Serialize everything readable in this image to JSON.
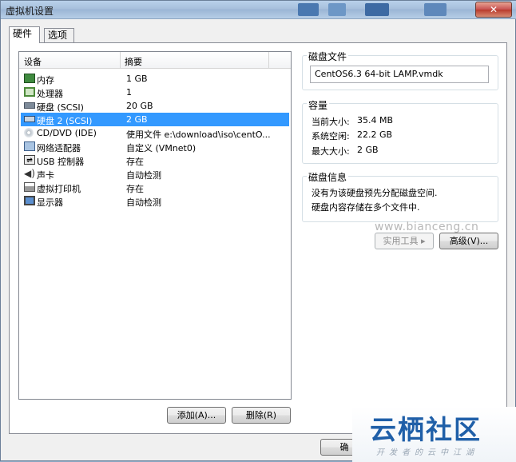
{
  "window": {
    "title": "虚拟机设置",
    "close_glyph": "✕"
  },
  "tabs": [
    {
      "label": "硬件"
    },
    {
      "label": "选项"
    }
  ],
  "device_table": {
    "headers": {
      "device": "设备",
      "summary": "摘要"
    },
    "rows": [
      {
        "name": "内存",
        "summary": "1 GB",
        "icon": "memory-icon"
      },
      {
        "name": "处理器",
        "summary": "1",
        "icon": "processor-icon"
      },
      {
        "name": "硬盘 (SCSI)",
        "summary": "20 GB",
        "icon": "hard-disk-icon"
      },
      {
        "name": "硬盘 2 (SCSI)",
        "summary": "2 GB",
        "icon": "hard-disk-icon"
      },
      {
        "name": "CD/DVD (IDE)",
        "summary": "使用文件 e:\\download\\iso\\centO...",
        "icon": "cd-dvd-icon"
      },
      {
        "name": "网络适配器",
        "summary": "自定义 (VMnet0)",
        "icon": "network-adapter-icon"
      },
      {
        "name": "USB 控制器",
        "summary": "存在",
        "icon": "usb-icon"
      },
      {
        "name": "声卡",
        "summary": "自动检测",
        "icon": "sound-card-icon"
      },
      {
        "name": "虚拟打印机",
        "summary": "存在",
        "icon": "printer-icon"
      },
      {
        "name": "显示器",
        "summary": "自动检测",
        "icon": "display-icon"
      }
    ],
    "selected_index": 3
  },
  "buttons": {
    "add": "添加(A)...",
    "remove": "删除(R)",
    "utilities": "实用工具",
    "advanced": "高级(V)...",
    "ok": "确"
  },
  "disk_file": {
    "label": "磁盘文件",
    "value": "CentOS6.3 64-bit LAMP.vmdk"
  },
  "capacity": {
    "label": "容量",
    "current_label": "当前大小:",
    "current_value": "35.4 MB",
    "free_label": "系统空闲:",
    "free_value": "22.2 GB",
    "max_label": "最大大小:",
    "max_value": "2 GB"
  },
  "disk_info": {
    "label": "磁盘信息",
    "line1": "没有为该硬盘预先分配磁盘空间.",
    "line2": "硬盘内容存储在多个文件中."
  },
  "watermark": {
    "url": "www.bianceng.cn",
    "brand": "云栖社区",
    "slogan": "开发者的云中江湖"
  }
}
